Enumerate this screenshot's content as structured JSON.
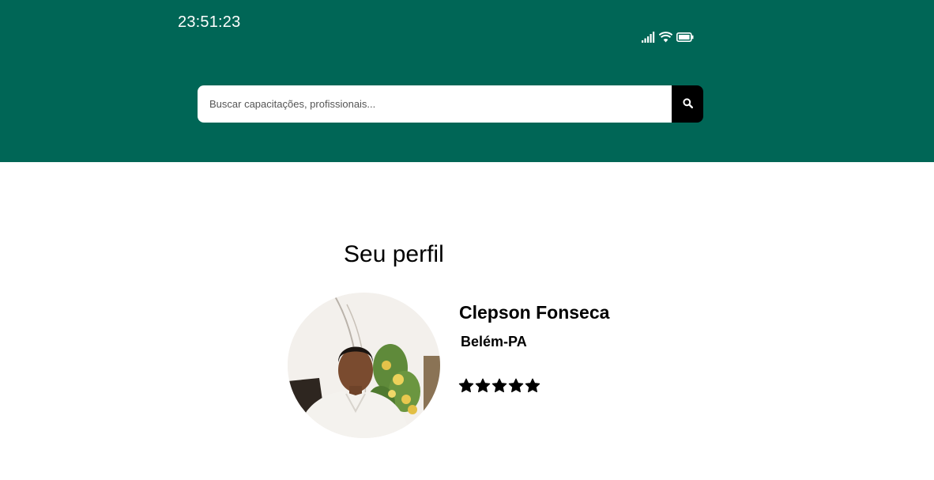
{
  "status_bar": {
    "time": "23:51:23",
    "icons": [
      "signal-icon",
      "wifi-icon",
      "battery-icon"
    ]
  },
  "search": {
    "placeholder": "Buscar capacitações, profissionais...",
    "value": "",
    "button_icon": "search-icon"
  },
  "profile": {
    "section_title": "Seu perfil",
    "name": "Clepson Fonseca",
    "location": "Belém-PA",
    "rating": 5,
    "rating_max": 5,
    "avatar_icon": "profile-photo"
  },
  "colors": {
    "header_bg": "#006656",
    "search_button_bg": "#000000",
    "text": "#000000",
    "star": "#000000"
  }
}
